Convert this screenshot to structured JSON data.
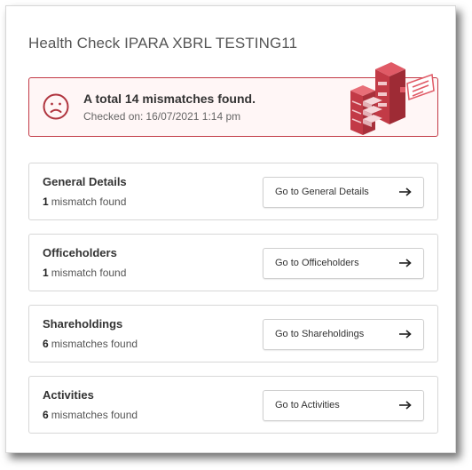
{
  "header": {
    "title": "Health Check IPARA XBRL TESTING11"
  },
  "alert": {
    "title": "A total 14 mismatches found.",
    "checked_label": "Checked on:",
    "checked_value": "16/07/2021 1:14 pm",
    "icon": "sad-face-icon",
    "illustration": "server-racks-illustration"
  },
  "sections": [
    {
      "name": "General Details",
      "count": "1",
      "count_text": "mismatch found",
      "button": "Go to General Details"
    },
    {
      "name": "Officeholders",
      "count": "1",
      "count_text": "mismatch found",
      "button": "Go to Officeholders"
    },
    {
      "name": "Shareholdings",
      "count": "6",
      "count_text": "mismatches found",
      "button": "Go to Shareholdings"
    },
    {
      "name": "Activities",
      "count": "6",
      "count_text": "mismatches found",
      "button": "Go to Activities"
    }
  ],
  "colors": {
    "accent": "#c23a46",
    "alert_bg": "#fff6f6",
    "border": "#d7d7d7"
  }
}
